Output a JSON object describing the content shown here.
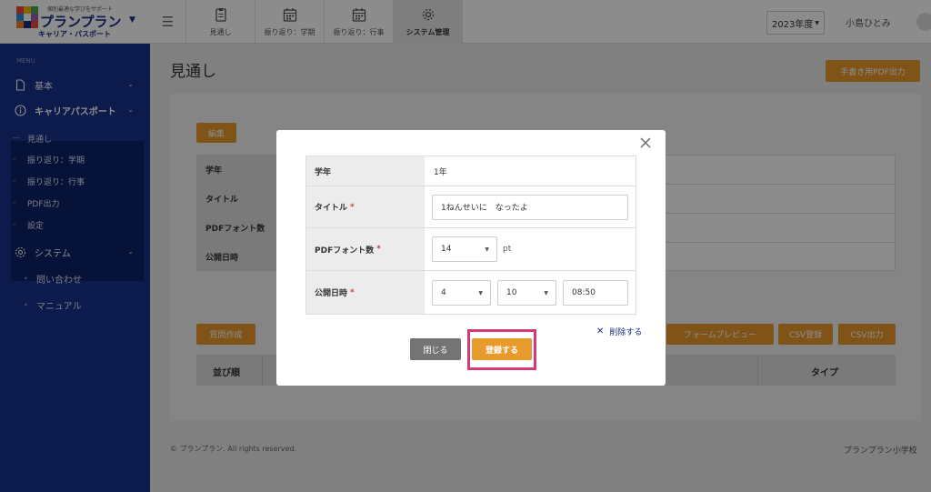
{
  "header": {
    "logo": {
      "tagline": "個別最適な学びをサポート",
      "name": "プランプラン",
      "subtitle": "キャリア・パスポート"
    },
    "tabs": [
      {
        "label": "見通し",
        "icon": "clipboard-icon",
        "active": false
      },
      {
        "label": "振り返り：学期",
        "icon": "calendar-icon",
        "active": false
      },
      {
        "label": "振り返り：行事",
        "icon": "calendar-icon",
        "active": false
      },
      {
        "label": "システム管理",
        "icon": "gear-icon",
        "active": true
      }
    ],
    "year_select": "2023年度",
    "user_name": "小島ひとみ"
  },
  "sidebar": {
    "menu_label": "MENU",
    "items": [
      {
        "label": "基本",
        "icon": "document-icon"
      },
      {
        "label": "キャリアパスポート",
        "icon": "info-circle-icon"
      },
      {
        "label": "システム",
        "icon": "gear-icon"
      }
    ],
    "career_sub": [
      "見通し",
      "振り返り：学期",
      "振り返り：行事",
      "PDF出力",
      "設定"
    ],
    "system_sub": [
      "問い合わせ",
      "マニュアル"
    ]
  },
  "main": {
    "page_title": "見通し",
    "pdf_button": "手書き用PDF出力",
    "edit_button": "編集",
    "info_rows": [
      "学年",
      "タイトル",
      "PDFフォント数",
      "公開日時"
    ],
    "create_question_button": "質問作成",
    "form_preview_button": "フォームプレビュー",
    "csv_import_button": "CSV登録",
    "csv_export_button": "CSV出力",
    "list_headers": {
      "order": "並び順",
      "type": "タイプ"
    }
  },
  "footer": {
    "copyright": "© プランプラン. All rights reserved.",
    "school": "プランプラン小学校"
  },
  "modal": {
    "rows": {
      "grade": {
        "label": "学年",
        "value": "1年"
      },
      "title": {
        "label": "タイトル",
        "required": "*",
        "value": "1ねんせいに　なったよ"
      },
      "font": {
        "label": "PDFフォント数",
        "required": "*",
        "value": "14",
        "unit": "pt"
      },
      "publish": {
        "label": "公開日時",
        "required": "*",
        "month": "4",
        "day": "10",
        "time": "08:50"
      }
    },
    "delete_label": "削除する",
    "close_button": "閉じる",
    "submit_button": "登録する"
  },
  "colors": {
    "sidebar": "#16308a",
    "accent": "#e99a2c",
    "highlight": "#d33a7c"
  }
}
